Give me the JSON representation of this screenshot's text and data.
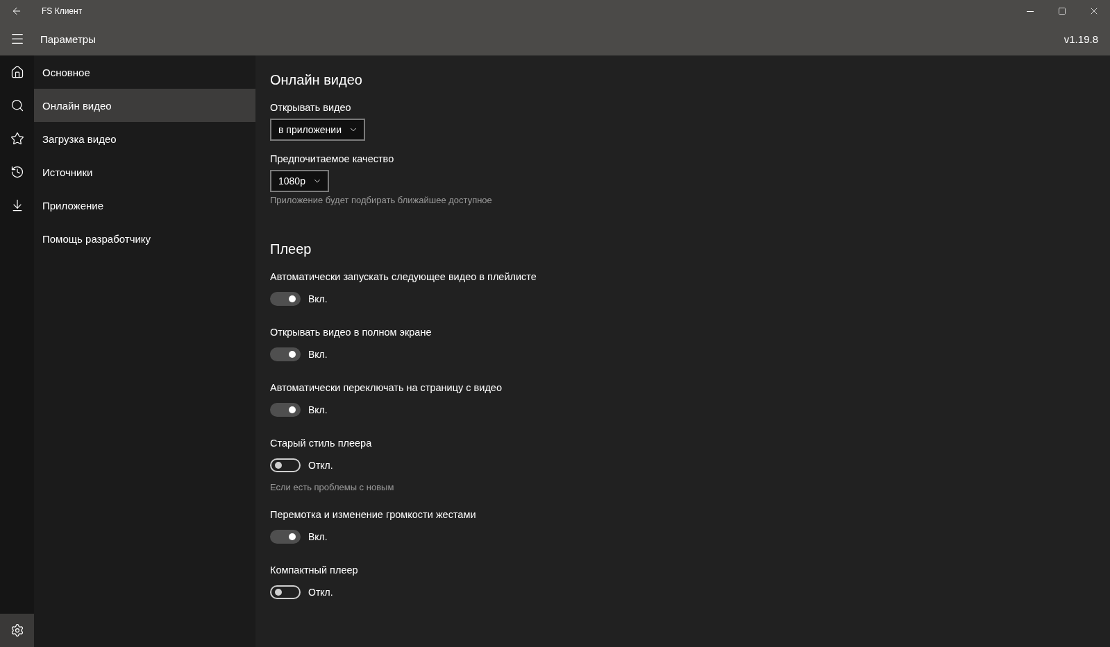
{
  "window": {
    "title": "FS Клиент"
  },
  "header": {
    "title": "Параметры",
    "version": "v1.19.8"
  },
  "rail": [
    {
      "kind": "home",
      "selected": false
    },
    {
      "kind": "search",
      "selected": false
    },
    {
      "kind": "star",
      "selected": false
    },
    {
      "kind": "history",
      "selected": false
    },
    {
      "kind": "download",
      "selected": false
    }
  ],
  "rail_footer": {
    "kind": "settings",
    "selected": true
  },
  "nav": [
    {
      "label": "Основное",
      "selected": false
    },
    {
      "label": "Онлайн видео",
      "selected": true
    },
    {
      "label": "Загрузка видео",
      "selected": false
    },
    {
      "label": "Источники",
      "selected": false
    },
    {
      "label": "Приложение",
      "selected": false
    },
    {
      "label": "Помощь разработчику",
      "selected": false
    }
  ],
  "sections": [
    {
      "title": "Онлайн видео",
      "items": [
        {
          "kind": "dropdown",
          "label": "Открывать видео",
          "value": "в приложении"
        },
        {
          "kind": "dropdown",
          "label": "Предпочитаемое качество",
          "value": "1080p",
          "hint": "Приложение будет подбирать ближайшее доступное"
        }
      ]
    },
    {
      "title": "Плеер",
      "items": [
        {
          "kind": "toggle",
          "label": "Автоматически запускать следующее видео в плейлисте",
          "on": true,
          "state_text": "Вкл."
        },
        {
          "kind": "toggle",
          "label": "Открывать видео в полном экране",
          "on": true,
          "state_text": "Вкл."
        },
        {
          "kind": "toggle",
          "label": "Автоматически переключать на страницу с видео",
          "on": true,
          "state_text": "Вкл."
        },
        {
          "kind": "toggle",
          "label": "Старый стиль плеера",
          "on": false,
          "state_text": "Откл.",
          "hint": "Если есть проблемы с новым"
        },
        {
          "kind": "toggle",
          "label": "Перемотка и изменение громкости жестами",
          "on": true,
          "state_text": "Вкл."
        },
        {
          "kind": "toggle",
          "label": "Компактный плеер",
          "on": false,
          "state_text": "Откл."
        }
      ]
    }
  ]
}
